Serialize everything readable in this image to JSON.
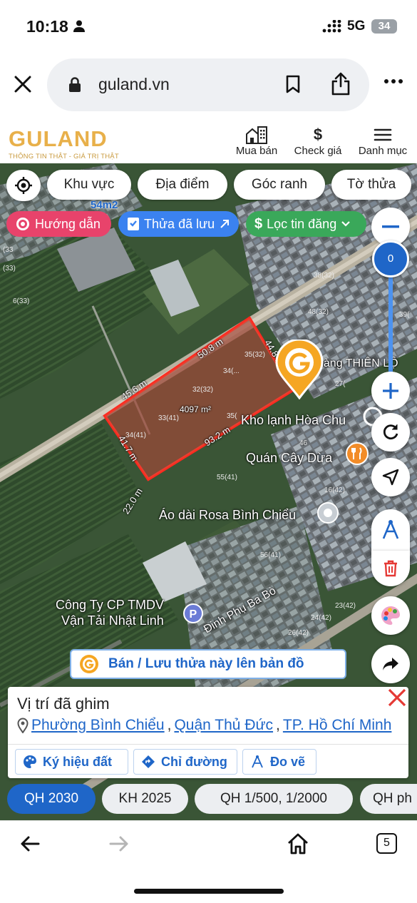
{
  "status": {
    "time": "10:18",
    "network": "5G",
    "battery": "34"
  },
  "browser": {
    "url": "guland.vn"
  },
  "site": {
    "logo_text": "GULAND",
    "tagline": "THÔNG TIN THẬT - GIÁ TRỊ THẬT",
    "nav": [
      {
        "label": "Mua bán",
        "icon": "building-icon"
      },
      {
        "label": "Check giá",
        "icon": "dollar-icon"
      },
      {
        "label": "Danh mục",
        "icon": "menu-icon"
      }
    ]
  },
  "map": {
    "filters": [
      "Khu vực",
      "Địa điểm",
      "Góc ranh",
      "Tờ thửa"
    ],
    "pills": {
      "guide": "Hướng dẫn",
      "saved": "Thửa đã lưu",
      "filter": "Lọc tin đăng"
    },
    "zoom_level": "0",
    "labels": {
      "area_top": "54m2",
      "area_center": "4097 m²",
      "edge_top": "50.8 m",
      "edge_right": "44.8 m",
      "edge_left_top": "45.6 m",
      "edge_left": "41.7 m",
      "edge_bottom": "93.2 m",
      "road": "22.0 m",
      "poi_kho": "Kho lạnh Hòa Chu",
      "poi_quan": "Quán Cây Dừa",
      "poi_aodai": "Áo dài Rosa Bình Chiểu",
      "poi_congty_1": "Công Ty CP TMDV",
      "poi_congty_2": "Vận Tải Nhật Linh",
      "poi_hang": "hàng THIÊN LỘ",
      "street": "Đinh Phụ Ba Bò"
    },
    "save_button": "Bán / Lưu thửa này lên bản đồ"
  },
  "panel": {
    "title": "Vị trí đã ghim",
    "ward": "Phường Bình Chiểu",
    "district": "Quận Thủ Đức",
    "city": "TP. Hồ Chí Minh",
    "tools": [
      "Ký hiệu đất",
      "Chỉ đường",
      "Đo vẽ"
    ]
  },
  "tabs": [
    "QH 2030",
    "KH 2025",
    "QH 1/500, 1/2000",
    "QH ph"
  ],
  "bottom_nav": {
    "tabs_count": "5"
  },
  "colors": {
    "accent": "#1f66c8",
    "brand": "#e8b04a",
    "danger": "#e53935",
    "green": "#34a853"
  }
}
